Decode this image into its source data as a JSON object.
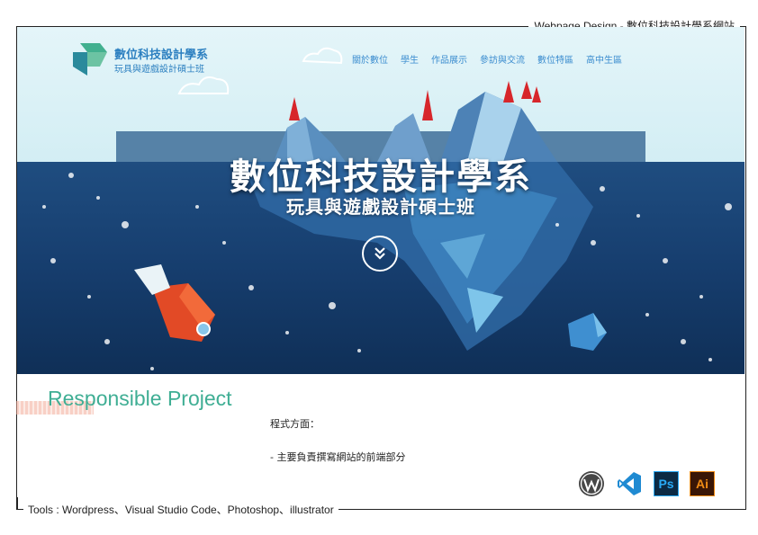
{
  "frame": {
    "title": "Webpage Design - 數位科技設計學系網站",
    "tools_line": "Tools : Wordpress、Visual Studio Code、Photoshop、illustrator"
  },
  "site": {
    "logo_line1": "數位科技設計學系",
    "logo_line2": "玩具與遊戲設計碩士班",
    "nav": [
      {
        "label": "關於數位"
      },
      {
        "label": "學生"
      },
      {
        "label": "作品展示"
      },
      {
        "label": "參訪與交流"
      },
      {
        "label": "數位特區"
      },
      {
        "label": "高中生區"
      }
    ],
    "hero_title": "數位科技設計學系",
    "hero_subtitle": "玩具與遊戲設計碩士班"
  },
  "section": {
    "title": "Responsible Project",
    "line1": "程式方面：",
    "line2": "- 主要負責撰寫網站的前端部分"
  },
  "tool_icons": [
    {
      "icon": "wordpress-icon"
    },
    {
      "icon": "visual-studio-code-icon"
    },
    {
      "icon": "photoshop-icon",
      "label": "Ps"
    },
    {
      "icon": "illustrator-icon",
      "label": "Ai"
    }
  ],
  "colors": {
    "accent_green": "#3fae94",
    "nav_blue": "#3a8ccf",
    "sea_blue": "#173f70"
  }
}
